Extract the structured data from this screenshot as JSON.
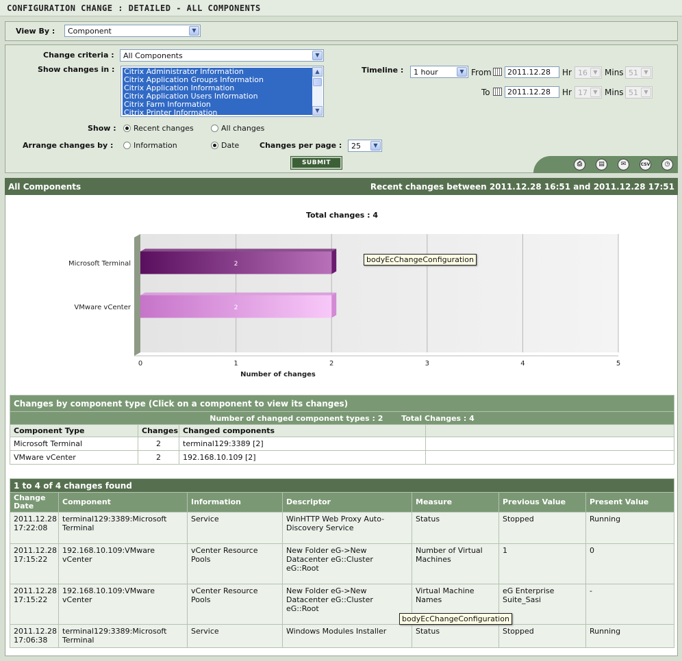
{
  "page_title": "CONFIGURATION CHANGE : DETAILED - ALL COMPONENTS",
  "view_by": {
    "label": "View By  :",
    "value": "Component"
  },
  "criteria": {
    "change_criteria_label": "Change criteria :",
    "change_criteria_value": "All Components",
    "show_changes_in_label": "Show changes in :",
    "show_changes_items": [
      "Citrix Administrator Information",
      "Citrix Application Groups Information",
      "Citrix Application Information",
      "Citrix Application Users Information",
      "Citrix Farm Information",
      "Citrix Printer Information"
    ],
    "show_label": "Show :",
    "show_options": [
      "Recent changes",
      "All changes"
    ],
    "arrange_label": "Arrange changes by :",
    "arrange_options": [
      "Information",
      "Date"
    ],
    "per_page_label": "Changes per page :",
    "per_page_value": "25",
    "timeline_label": "Timeline :",
    "timeline_value": "1 hour",
    "from_label": "From",
    "to_label": "To",
    "from_date": "2011.12.28",
    "to_date": "2011.12.28",
    "hr_label": "Hr",
    "mins_label": "Mins",
    "from_hr": "16",
    "from_min": "51",
    "to_hr": "17",
    "to_min": "51",
    "submit_label": "SUBMIT"
  },
  "toolbar_icons": [
    "print-icon",
    "pdf-icon",
    "mail-icon",
    "csv-icon",
    "timer-icon"
  ],
  "section": {
    "title": "All Components",
    "range": "Recent changes between 2011.12.28 16:51 and 2011.12.28 17:51"
  },
  "chart_data": {
    "type": "bar",
    "orientation": "horizontal",
    "title": "Total changes : 4",
    "categories": [
      "Microsoft Terminal",
      "VMware vCenter"
    ],
    "values": [
      2,
      2
    ],
    "xlabel": "Number of changes",
    "ylabel": "",
    "xlim": [
      0,
      5
    ],
    "ticks": [
      "0",
      "1",
      "2",
      "3",
      "4",
      "5"
    ],
    "colors": [
      "#6a1b6e",
      "#d38ad6"
    ],
    "grid": true
  },
  "tooltip_text": "bodyEcChangeConfiguration",
  "type_table": {
    "caption": "Changes by component type (Click on a component to view its changes)",
    "summary_types": "Number of changed component types : 2",
    "summary_total": "Total Changes : 4",
    "headers": [
      "Component Type",
      "Changes",
      "Changed components",
      ""
    ],
    "rows": [
      [
        "Microsoft Terminal",
        "2",
        "terminal129:3389 [2]",
        ""
      ],
      [
        "VMware vCenter",
        "2",
        "192.168.10.109 [2]",
        ""
      ]
    ]
  },
  "changes_table": {
    "caption": "1 to 4 of 4 changes found",
    "headers": [
      "Change Date",
      "Component",
      "Information",
      "Descriptor",
      "Measure",
      "Previous Value",
      "Present Value"
    ],
    "rows": [
      [
        "2011.12.28 17:22:08",
        "terminal129:3389:Microsoft Terminal",
        "Service",
        "WinHTTP Web Proxy Auto-Discovery Service",
        "Status",
        "Stopped",
        "Running"
      ],
      [
        "2011.12.28 17:15:22",
        "192.168.10.109:VMware vCenter",
        "vCenter Resource Pools",
        "New Folder eG->New Datacenter eG::Cluster eG::Root",
        "Number of Virtual Machines",
        "1",
        "0"
      ],
      [
        "2011.12.28 17:15:22",
        "192.168.10.109:VMware vCenter",
        "vCenter Resource Pools",
        "New Folder eG->New Datacenter eG::Cluster eG::Root",
        "Virtual Machine Names",
        "eG Enterprise Suite_Sasi",
        "-"
      ],
      [
        "2011.12.28 17:06:38",
        "terminal129:3389:Microsoft Terminal",
        "Service",
        "Windows Modules Installer",
        "Status",
        "Stopped",
        "Running"
      ]
    ]
  }
}
